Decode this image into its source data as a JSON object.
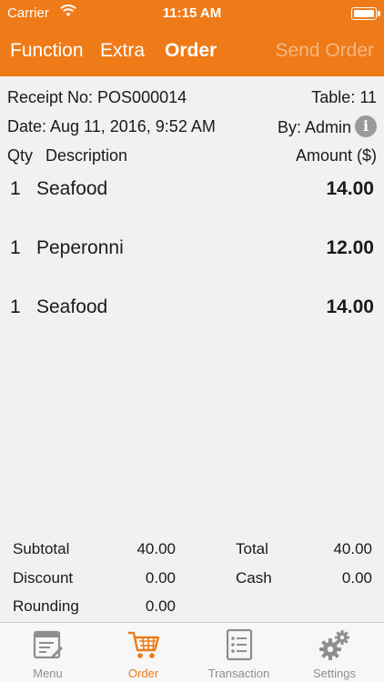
{
  "status_bar": {
    "carrier": "Carrier",
    "time": "11:15 AM"
  },
  "nav": {
    "function": "Function",
    "extra": "Extra",
    "order": "Order",
    "send_order": "Send Order"
  },
  "receipt": {
    "receipt_no": "Receipt No: POS000014",
    "table": "Table: 11",
    "date": "Date: Aug 11, 2016, 9:52 AM",
    "by": "By: Admin",
    "col_qty": "Qty",
    "col_description": "Description",
    "col_amount": "Amount ($)"
  },
  "items": [
    {
      "qty": "1",
      "description": "Seafood",
      "amount": "14.00"
    },
    {
      "qty": "1",
      "description": "Peperonni",
      "amount": "12.00"
    },
    {
      "qty": "1",
      "description": "Seafood",
      "amount": "14.00"
    }
  ],
  "totals": {
    "subtotal_label": "Subtotal",
    "subtotal_value": "40.00",
    "total_label": "Total",
    "total_value": "40.00",
    "discount_label": "Discount",
    "discount_value": "0.00",
    "cash_label": "Cash",
    "cash_value": "0.00",
    "rounding_label": "Rounding",
    "rounding_value": "0.00"
  },
  "tabs": [
    {
      "label": "Menu",
      "icon": "menu-icon"
    },
    {
      "label": "Order",
      "icon": "cart-icon"
    },
    {
      "label": "Transaction",
      "icon": "transaction-icon"
    },
    {
      "label": "Settings",
      "icon": "gear-icon"
    }
  ],
  "colors": {
    "accent": "#ee7a18",
    "tab_inactive": "#8e8e8e",
    "send_disabled": "#f6bd8c"
  }
}
